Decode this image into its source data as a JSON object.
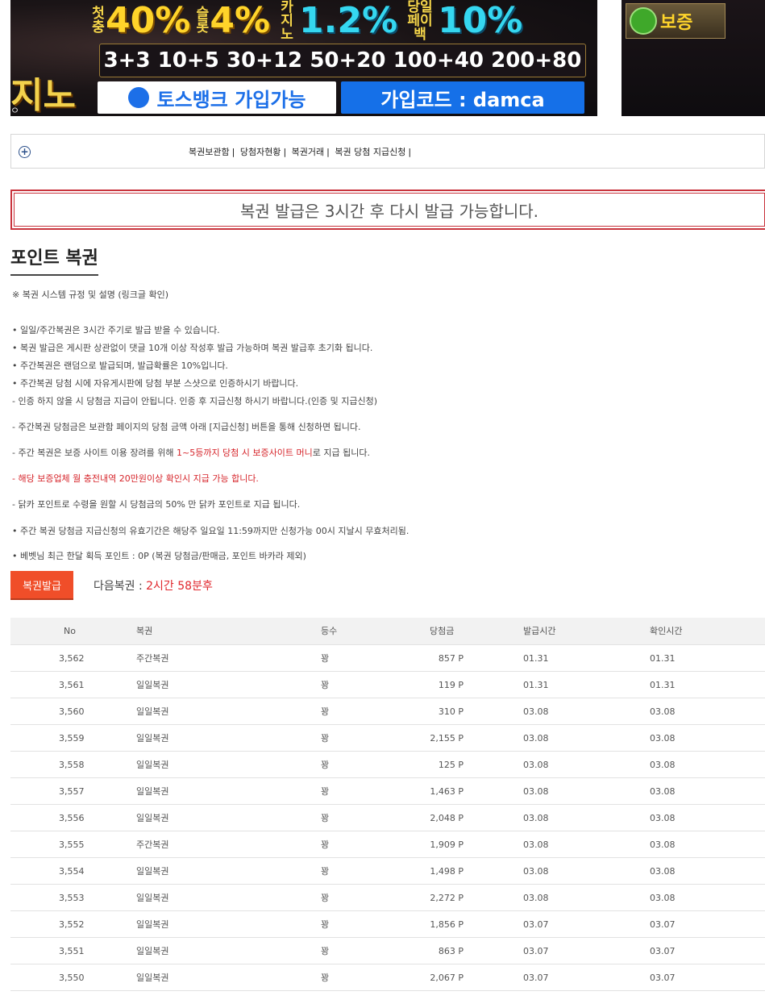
{
  "banner": {
    "side_text": "지노",
    "side_sub": "ㅇ",
    "promo": [
      {
        "pre": "첫충",
        "big": "40%"
      },
      {
        "pre": "슬롯",
        "big": "4%"
      },
      {
        "pre": "카지노",
        "big": "1.2%"
      },
      {
        "pre": "당일페이백",
        "big": "10%"
      }
    ],
    "bonus": [
      "3+3",
      "10+5",
      "30+12",
      "50+20",
      "100+40",
      "200+80"
    ],
    "toss": "토스뱅크 가입가능",
    "code": "가입코드 : damca"
  },
  "ad_right": {
    "label": "보증"
  },
  "nav": {
    "links": [
      "복권보관함",
      "당첨자현황",
      "복권거래",
      "복권 당첨 지급신청"
    ]
  },
  "notice": "복권 발급은 3시간 후 다시 발급 가능합니다.",
  "page_title": "포인트 복권",
  "rules": {
    "intro": "※ 복권 시스템 규정 및 설명 (링크글 확인)",
    "l1": "• 일일/주간복권은 3시간 주기로 발급 받을 수 있습니다.",
    "l2": "• 복권 발급은 게시판 상관없이 댓글 10개 이상 작성후 발급 가능하며 복권 발급후 초기화 됩니다.",
    "l3": "• 주간복권은 랜덤으로 발급되며, 발급확률은 10%입니다.",
    "l4": "• 주간복권 당첨 시에 자유게시판에 당첨 부분 스샷으로 인증하시기 바랍니다.",
    "l5": "  - 인증 하지 않을 시 당첨금 지급이 안됩니다. 인증 후 지급신청 하시기 바랍니다.(인증 및 지급신청)",
    "l6": "  - 주간복권 당첨금은 보관함 페이지의 당첨 금액 아래 [지급신청] 버튼을 통해 신청하면 됩니다.",
    "l7a": "  - 주간 복권은 보증 사이트 이용 장려를 위해 ",
    "l7b": "1~5등까지 당첨 시 보증사이트 머니",
    "l7c": "로 지급 됩니다.",
    "l8": "  - 해당 보증업체 월 충전내역 20만원이상 확인시 지급 가능 합니다.",
    "l9": "  - 닭카 포인트로 수령을 원할 시 당첨금의 50% 만 닭카 포인트로 지급 됩니다.",
    "l10": "• 주간 복권 당첨금 지급신청의 유효기간은 해당주 일요일 11:59까지만 신청가능 00시 지날시 무효처리됨.",
    "l11": "• 베벳님 최근 한달 획득 포인트 : 0P (복권 당첨금/판매금, 포인트 바카라 제외)"
  },
  "issue_button": "복권발급",
  "next_label": "다음복권 : ",
  "next_time": "2시간 58분후",
  "table": {
    "headers": [
      "No",
      "복권",
      "등수",
      "당첨금",
      "발급시간",
      "확인시간"
    ],
    "rows": [
      [
        "3,562",
        "주간복권",
        "꽝",
        "857 P",
        "01.31",
        "01.31"
      ],
      [
        "3,561",
        "일일복권",
        "꽝",
        "119 P",
        "01.31",
        "01.31"
      ],
      [
        "3,560",
        "일일복권",
        "꽝",
        "310 P",
        "03.08",
        "03.08"
      ],
      [
        "3,559",
        "일일복권",
        "꽝",
        "2,155 P",
        "03.08",
        "03.08"
      ],
      [
        "3,558",
        "일일복권",
        "꽝",
        "125 P",
        "03.08",
        "03.08"
      ],
      [
        "3,557",
        "일일복권",
        "꽝",
        "1,463 P",
        "03.08",
        "03.08"
      ],
      [
        "3,556",
        "일일복권",
        "꽝",
        "2,048 P",
        "03.08",
        "03.08"
      ],
      [
        "3,555",
        "주간복권",
        "꽝",
        "1,909 P",
        "03.08",
        "03.08"
      ],
      [
        "3,554",
        "일일복권",
        "꽝",
        "1,498 P",
        "03.08",
        "03.08"
      ],
      [
        "3,553",
        "일일복권",
        "꽝",
        "2,272 P",
        "03.08",
        "03.08"
      ],
      [
        "3,552",
        "일일복권",
        "꽝",
        "1,856 P",
        "03.07",
        "03.07"
      ],
      [
        "3,551",
        "일일복권",
        "꽝",
        "863 P",
        "03.07",
        "03.07"
      ],
      [
        "3,550",
        "일일복권",
        "꽝",
        "2,067 P",
        "03.07",
        "03.07"
      ]
    ]
  }
}
